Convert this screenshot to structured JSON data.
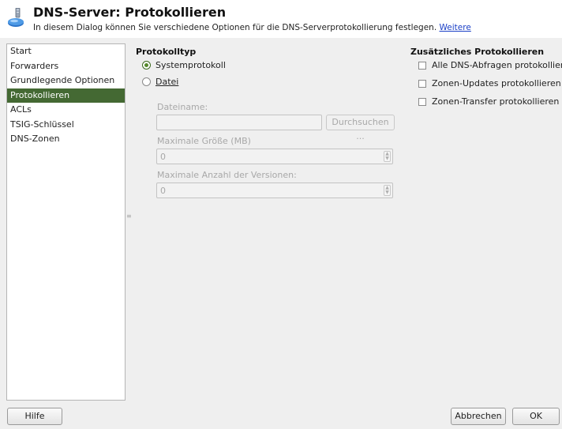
{
  "header": {
    "title": "DNS-Server: Protokollieren",
    "description": "In diesem Dialog können Sie verschiedene Optionen für die DNS-Serverprotokollierung festlegen.",
    "more_link": "Weitere"
  },
  "sidebar": {
    "items": [
      {
        "label": "Start",
        "active": false
      },
      {
        "label": "Forwarders",
        "active": false
      },
      {
        "label": "Grundlegende Optionen",
        "active": false
      },
      {
        "label": "Protokollieren",
        "active": true
      },
      {
        "label": "ACLs",
        "active": false
      },
      {
        "label": "TSIG-Schlüssel",
        "active": false
      },
      {
        "label": "DNS-Zonen",
        "active": false
      }
    ],
    "active_color": "#446933"
  },
  "log_type": {
    "title": "Protokolltyp",
    "system_log": {
      "label": "Systemprotokoll",
      "checked": true
    },
    "file": {
      "label": "Datei",
      "checked": false
    },
    "filename": {
      "label": "Dateiname:",
      "value": ""
    },
    "browse_button": "Durchsuchen ...",
    "max_size": {
      "label": "Maximale Größe (MB)",
      "value": "0"
    },
    "max_versions": {
      "label": "Maximale Anzahl der Versionen:",
      "value": "0"
    }
  },
  "additional_logging": {
    "title": "Zusätzliches Protokollieren",
    "options": [
      {
        "label": "Alle DNS-Abfragen protokollieren",
        "checked": false
      },
      {
        "label": "Zonen-Updates protokollieren",
        "checked": false
      },
      {
        "label": "Zonen-Transfer protokollieren",
        "checked": false
      }
    ]
  },
  "footer": {
    "help_button": "Hilfe",
    "cancel_button": "Abbrechen",
    "ok_button": "OK"
  }
}
